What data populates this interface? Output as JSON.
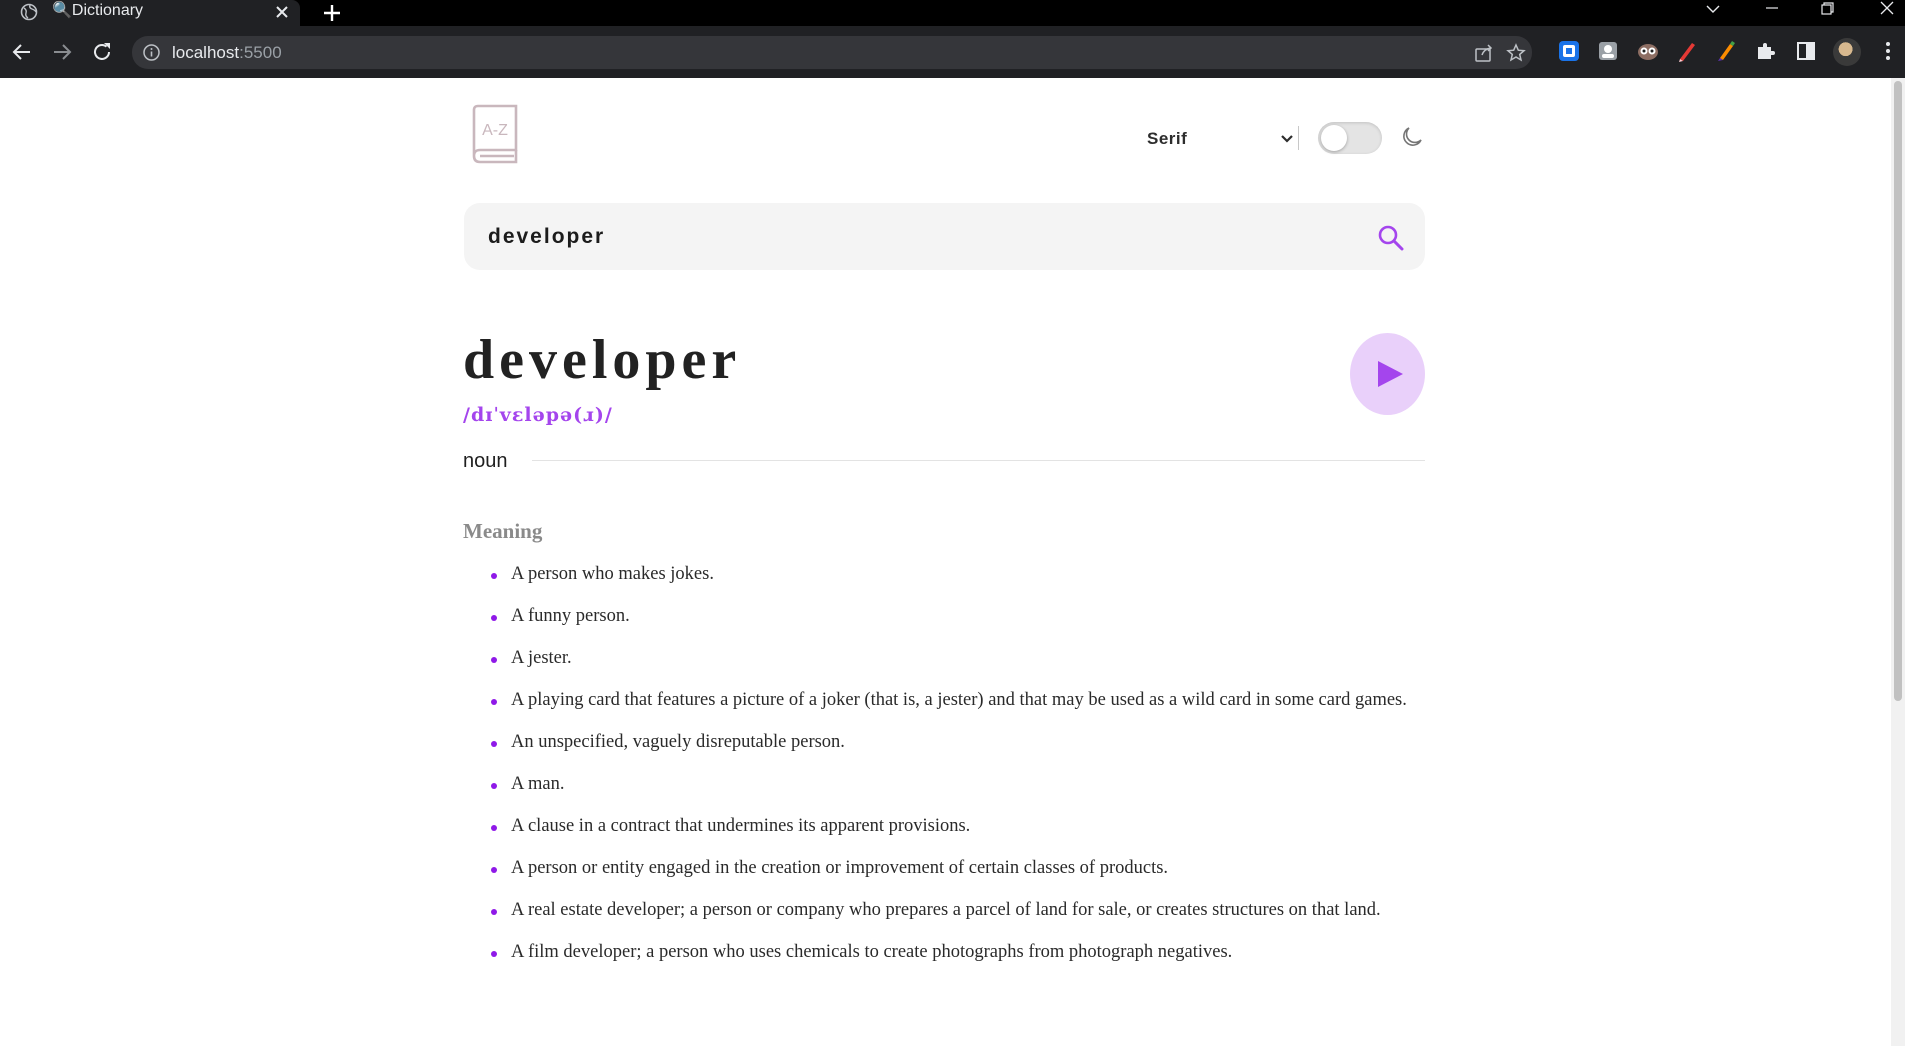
{
  "browser": {
    "tab_title": "🔍Dictionary",
    "url_host": "localhost",
    "url_port": ":5500"
  },
  "app": {
    "font_select_value": "Serif",
    "theme_toggle_on": false,
    "search_value": "developer",
    "accent_color": "#a445ed"
  },
  "entry": {
    "word": "developer",
    "phonetic": "/dɪˈvɛləpə(ɹ)/",
    "part_of_speech": "noun",
    "meaning_heading": "Meaning",
    "definitions": [
      "A person who makes jokes.",
      "A funny person.",
      "A jester.",
      "A playing card that features a picture of a joker (that is, a jester) and that may be used as a wild card in some card games.",
      "An unspecified, vaguely disreputable person.",
      "A man.",
      "A clause in a contract that undermines its apparent provisions.",
      "A person or entity engaged in the creation or improvement of certain classes of products.",
      "A real estate developer; a person or company who prepares a parcel of land for sale, or creates structures on that land.",
      "A film developer; a person who uses chemicals to create photographs from photograph negatives."
    ]
  }
}
